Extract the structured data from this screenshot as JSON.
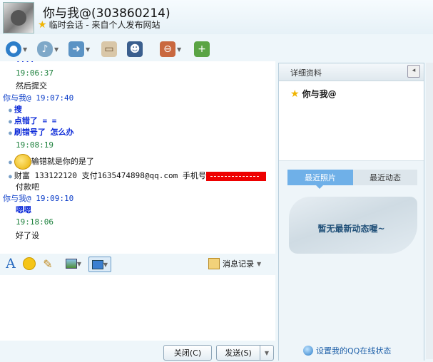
{
  "header": {
    "contact_title": "你与我@(303860214)",
    "session_info": "临时会话 - 来自个人发布网站"
  },
  "toolbar": {
    "icons": [
      "video-call-icon",
      "voice-call-icon",
      "send-file-icon",
      "whiteboard-icon",
      "remote-assist-icon",
      "block-user-icon",
      "add-friend-icon"
    ]
  },
  "chat": {
    "lines": [
      {
        "kind": "text",
        "text": "然后提交"
      },
      {
        "kind": "ts",
        "text": "19:06:37"
      },
      {
        "kind": "sender",
        "text": "你与我@  19:07:40"
      },
      {
        "kind": "bold",
        "text": "搜"
      },
      {
        "kind": "bold",
        "text": "点错了  = ="
      },
      {
        "kind": "bold",
        "text": "刷错号了    怎么办"
      },
      {
        "kind": "ts",
        "text": "19:08:19"
      },
      {
        "kind": "text",
        "text": "输错就是你的是了"
      },
      {
        "kind": "text",
        "text": "财富 133122120 支付1635474898@qq.com 手机号"
      },
      {
        "kind": "text",
        "text": "付款吧"
      },
      {
        "kind": "sender",
        "text": "你与我@  19:09:10"
      },
      {
        "kind": "bold",
        "text": "嗯嗯"
      },
      {
        "kind": "ts",
        "text": "19:18:06"
      },
      {
        "kind": "text",
        "text": "好了设"
      }
    ]
  },
  "inputbar": {
    "history_label": "消息记录"
  },
  "footer": {
    "close_label": "关闭(C)",
    "send_label": "发送(S)"
  },
  "sidebar": {
    "header_label": "详细资料",
    "name": "你与我@",
    "tabs": [
      {
        "label": "最近照片",
        "active": true
      },
      {
        "label": "最近动态",
        "active": false
      }
    ],
    "empty_message": "暂无最新动态喔~",
    "qq_status_link": "设置我的QQ在线状态"
  },
  "colors": {
    "timestamp": "#1a7f3a",
    "sender": "#0a3cc8",
    "redaction": "#ee0000",
    "tab_active": "#6fb0e8"
  }
}
